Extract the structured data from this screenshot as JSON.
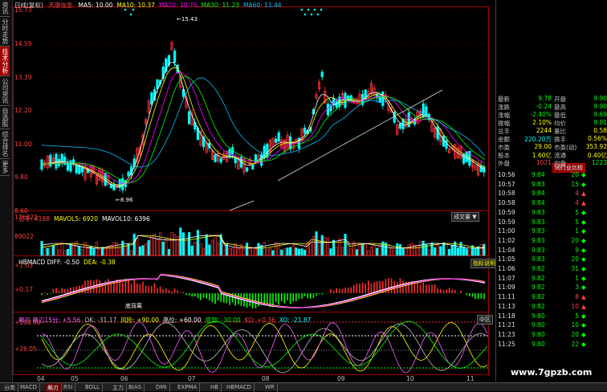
{
  "sidebar": [
    "资讯",
    "分时走势",
    "技术分析",
    "公司资讯",
    "自选股",
    "综合排名",
    "更多"
  ],
  "sidebar_active": 2,
  "main": {
    "title": "日线(复权)",
    "stock_name": "天康信息",
    "ma_legend": [
      {
        "label": "MA5: 10.00",
        "color": "#ffffff"
      },
      {
        "label": "MA10: 10.37",
        "color": "#ffff00"
      },
      {
        "label": "MA20: 10.75",
        "color": "#ff00ff"
      },
      {
        "label": "MA30: 11.23",
        "color": "#00ff00"
      },
      {
        "label": "MA60: 11.44",
        "color": "#00c0ff"
      }
    ],
    "price_axis": [
      "15.73",
      "14.59",
      "13.39",
      "12.20",
      "11.00",
      "9.80",
      "8.60"
    ],
    "high_mark": "15.43",
    "low_mark": "8.96"
  },
  "volume": {
    "legend": [
      {
        "label": "总手: 4188",
        "color": "#ff4040"
      },
      {
        "label": "MAVOL5: 6920",
        "color": "#ffff00"
      },
      {
        "label": "MAVOL10: 6396",
        "color": "#ffffff"
      }
    ],
    "axis": [
      "176022",
      "89022"
    ],
    "button": "成交量"
  },
  "macd": {
    "legend": [
      {
        "label": "HBMACD DIFF: -0.50",
        "color": "#ffffff"
      },
      {
        "label": "DEA: -0.38",
        "color": "#ffff00"
      }
    ],
    "axis": [
      "+1.03",
      "+0.17"
    ],
    "button": "指标说明",
    "annotation": "底背离"
  },
  "osc": {
    "legend": [
      {
        "label": "飙刃 飙刃15分: +5.56",
        "color": "#ff60ff"
      },
      {
        "label": "OK: -31.17",
        "color": "#c0c0c0"
      },
      {
        "label": "风险: +90.00",
        "color": "#ffff00"
      },
      {
        "label": "高位: +60.00",
        "color": "#ffffff"
      },
      {
        "label": "底部: -30.00",
        "color": "#00ff00"
      },
      {
        "label": "KO: +0.36",
        "color": "#ff4040"
      },
      {
        "label": "XO: -21.87",
        "color": "#00ffff"
      }
    ],
    "axis": [
      "+100.00",
      "+26.05"
    ],
    "button": "中区"
  },
  "x_axis": [
    "04",
    "05",
    "06",
    "07",
    "08",
    "09",
    "10",
    "11"
  ],
  "quote": [
    {
      "k1": "最新",
      "v1": "9.78",
      "k2": "开盘",
      "v2": "9.90",
      "c1": "#00ff00",
      "c2": "#00ff00"
    },
    {
      "k1": "涨跌",
      "v1": "-0.24",
      "k2": "最高",
      "v2": "9.90",
      "c1": "#00ff00",
      "c2": "#00ff00"
    },
    {
      "k1": "涨幅",
      "v1": "-2.40%",
      "k2": "最低",
      "v2": "9.69",
      "c1": "#00ff00",
      "c2": "#00ff00"
    },
    {
      "k1": "振幅",
      "v1": "2.10%",
      "k2": "均价",
      "v2": "9.81",
      "c1": "#ffff00",
      "c2": "#00ff00"
    },
    {
      "k1": "总手",
      "v1": "2244",
      "k2": "量比",
      "v2": "0.58",
      "c1": "#ffff00",
      "c2": "#ffff00"
    },
    {
      "k1": "金额",
      "v1": "220.20万",
      "k2": "换手",
      "v2": "0.56%",
      "c1": "#00ffff",
      "c2": "#ffff00"
    },
    {
      "k1": "市盈",
      "v1": "29.00",
      "k2": "市盈(动)",
      "v2": "353.92",
      "c1": "#ffff00",
      "c2": "#ffff00"
    },
    {
      "k1": "股本",
      "v1": "1.60亿",
      "k2": "流通",
      "v2": "0.40亿",
      "c1": "#ffff00",
      "c2": "#ffff00"
    },
    {
      "k1": "外盘",
      "v1": "1021",
      "k2": "内盘",
      "v2": "1223",
      "c1": "#ff4040",
      "c2": "#00ff00"
    }
  ],
  "compare_button": "同行业比较",
  "ticks": [
    {
      "time": "10:56",
      "price": "9.84",
      "vol": "20",
      "dir": "down"
    },
    {
      "time": "10:57",
      "price": "9.83",
      "vol": "15",
      "dir": "down"
    },
    {
      "time": "10:58",
      "price": "9.84",
      "vol": "4",
      "dir": "up"
    },
    {
      "time": "10:58",
      "price": "9.84",
      "vol": "4",
      "dir": "up"
    },
    {
      "time": "10:59",
      "price": "9.83",
      "vol": "5",
      "dir": "down"
    },
    {
      "time": "10:59",
      "price": "9.83",
      "vol": "5",
      "dir": "down"
    },
    {
      "time": "11:00",
      "price": "9.83",
      "vol": "1",
      "dir": "down"
    },
    {
      "time": "11:02",
      "price": "9.83",
      "vol": "20",
      "dir": "down"
    },
    {
      "time": "11:04",
      "price": "9.83",
      "vol": "9",
      "dir": "down"
    },
    {
      "time": "11:05",
      "price": "9.83",
      "vol": "20",
      "dir": "down"
    },
    {
      "time": "11:06",
      "price": "9.82",
      "vol": "31",
      "dir": "down"
    },
    {
      "time": "11:07",
      "price": "9.82",
      "vol": "1",
      "dir": "down"
    },
    {
      "time": "11:09",
      "price": "9.82",
      "vol": "3",
      "dir": "down"
    },
    {
      "time": "11:11",
      "price": "9.82",
      "vol": "8",
      "dir": "up"
    },
    {
      "time": "11:13",
      "price": "9.82",
      "vol": "10",
      "dir": "up"
    },
    {
      "time": "11:18",
      "price": "9.80",
      "vol": "5",
      "dir": "down"
    },
    {
      "time": "11:21",
      "price": "9.80",
      "vol": "10",
      "dir": "down"
    },
    {
      "time": "11:23",
      "price": "9.80",
      "vol": "20",
      "dir": "down"
    },
    {
      "time": "11:25",
      "price": "9.80",
      "vol": "22",
      "dir": "down"
    }
  ],
  "tabs": [
    "分类",
    "MACD",
    "飙刃",
    "RSI",
    "BOLL",
    "主力",
    "BIAS",
    "DMI",
    "EXPMA",
    "HB",
    "HBMACD",
    "WR"
  ],
  "tab_active": 2,
  "watermark": "www.7gpzb.com"
}
